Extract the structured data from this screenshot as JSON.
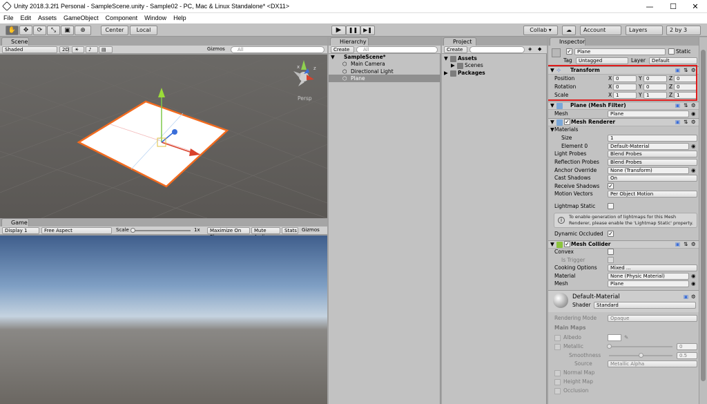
{
  "window": {
    "title": "Unity 2018.3.2f1 Personal - SampleScene.unity - Sample02 - PC, Mac & Linux Standalone* <DX11>",
    "controls": [
      "—",
      "☐",
      "✕"
    ]
  },
  "menu": [
    "File",
    "Edit",
    "Assets",
    "GameObject",
    "Component",
    "Window",
    "Help"
  ],
  "toolbar": {
    "tools": [
      "✋",
      "✥",
      "⟳",
      "⤡",
      "▣",
      "⊕"
    ],
    "pivot": "Center",
    "space": "Local",
    "play": "▶",
    "pause": "❚❚",
    "step": "▶❚",
    "collab": "Collab ▾",
    "account": "Account",
    "layers": "Layers",
    "layout": "2 by 3"
  },
  "scene": {
    "tab": "Scene",
    "shading": "Shaded",
    "mode2d": "2D",
    "gizmos": "Gizmos",
    "search": "All",
    "persp": "Persp",
    "axis_x": "x",
    "axis_z": "z"
  },
  "game": {
    "tab": "Game",
    "display": "Display 1",
    "aspect": "Free Aspect",
    "scale_label": "Scale",
    "scale_value": "1x",
    "maximize": "Maximize On Play",
    "mute": "Mute Audio",
    "stats": "Stats",
    "gizmos": "Gizmos"
  },
  "hierarchy": {
    "tab": "Hierarchy",
    "create": "Create",
    "search": "All",
    "scene": "SampleScene*",
    "items": [
      "Main Camera",
      "Directional Light",
      "Plane"
    ]
  },
  "project": {
    "tab": "Project",
    "create": "Create",
    "assets": "Assets",
    "scenes": "Scenes",
    "packages": "Packages"
  },
  "inspector": {
    "tab": "Inspector",
    "object_name": "Plane",
    "static": "Static",
    "tag_label": "Tag",
    "tag_value": "Untagged",
    "layer_label": "Layer",
    "layer_value": "Default",
    "transform": {
      "title": "Transform",
      "position": "Position",
      "rotation": "Rotation",
      "scale": "Scale",
      "pos": [
        "0",
        "0",
        "0"
      ],
      "rot": [
        "0",
        "0",
        "0"
      ],
      "scl": [
        "1",
        "1",
        "1"
      ],
      "axes": [
        "X",
        "Y",
        "Z"
      ]
    },
    "mesh_filter": {
      "title": "Plane (Mesh Filter)",
      "mesh_label": "Mesh",
      "mesh_value": "Plane"
    },
    "mesh_renderer": {
      "title": "Mesh Renderer",
      "materials": "Materials",
      "size_label": "Size",
      "size_value": "1",
      "element0_label": "Element 0",
      "element0_value": "Default-Material",
      "light_probes_label": "Light Probes",
      "light_probes_value": "Blend Probes",
      "reflection_probes_label": "Reflection Probes",
      "reflection_probes_value": "Blend Probes",
      "anchor_label": "Anchor Override",
      "anchor_value": "None (Transform)",
      "cast_label": "Cast Shadows",
      "cast_value": "On",
      "receive_label": "Receive Shadows",
      "motion_label": "Motion Vectors",
      "motion_value": "Per Object Motion",
      "lightmap_label": "Lightmap Static",
      "info": "To enable generation of lightmaps for this Mesh Renderer, please enable the 'Lightmap Static' property.",
      "dynamic_label": "Dynamic Occluded"
    },
    "mesh_collider": {
      "title": "Mesh Collider",
      "convex": "Convex",
      "trigger": "Is Trigger",
      "cooking_label": "Cooking Options",
      "cooking_value": "Mixed ...",
      "material_label": "Material",
      "material_value": "None (Physic Material)",
      "mesh_label": "Mesh",
      "mesh_value": "Plane"
    },
    "material": {
      "name": "Default-Material",
      "shader_label": "Shader",
      "shader_value": "Standard",
      "rendering_label": "Rendering Mode",
      "rendering_value": "Opaque",
      "main_maps": "Main Maps",
      "albedo": "Albedo",
      "metallic": "Metallic",
      "metallic_value": "0",
      "smoothness": "Smoothness",
      "smoothness_value": "0.5",
      "source_label": "Source",
      "source_value": "Metallic Alpha",
      "normal": "Normal Map",
      "height": "Height Map",
      "occlusion": "Occlusion"
    }
  },
  "colors": {
    "highlight_box": "#e01b1b",
    "selection_orange": "#f26b1f",
    "hierarchy_selected": "#8f8f8f"
  }
}
